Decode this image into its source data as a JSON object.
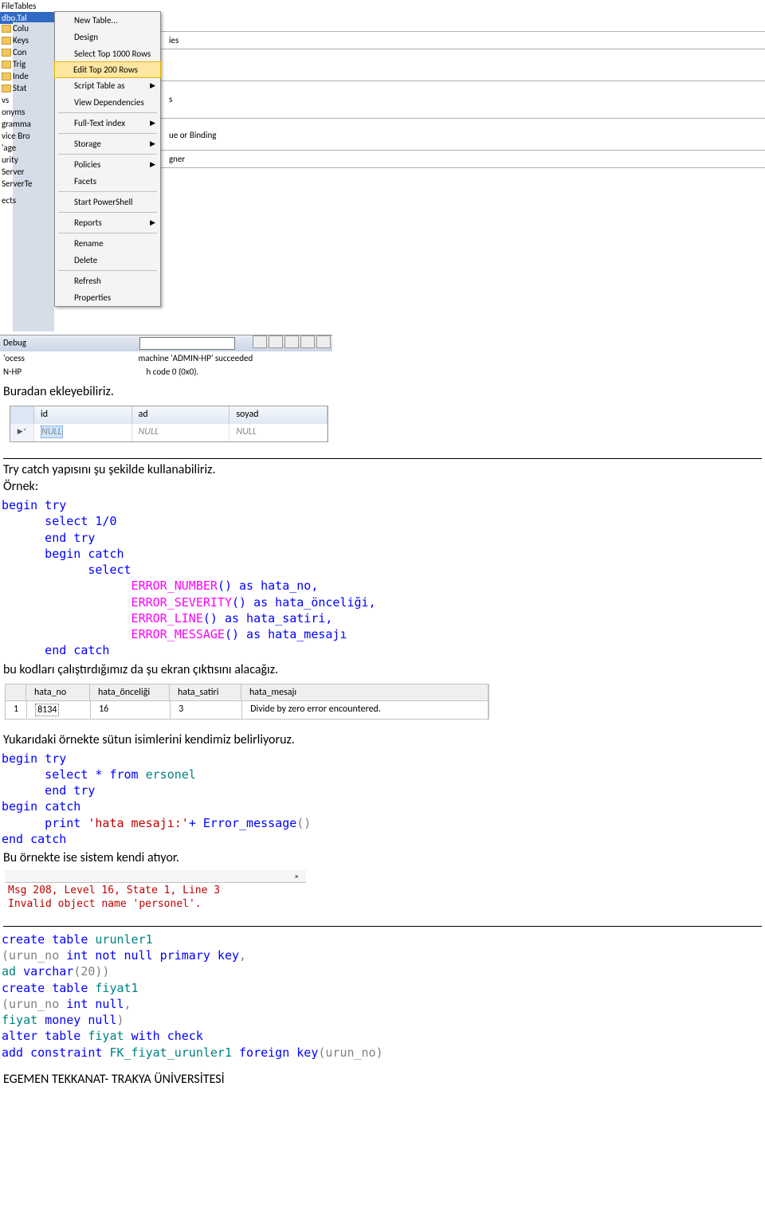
{
  "ssms": {
    "tree_header": "FileTables",
    "tree_selected": "dbo.Tal",
    "tree_items": [
      "Colu",
      "Keys",
      "Con",
      "Trig",
      "Inde",
      "Stat"
    ],
    "tree_plain": [
      "vs",
      "onyms",
      "gramma",
      "vice Bro",
      "'age",
      "urity",
      "Server",
      "ServerTe"
    ],
    "tree_item9": "ects",
    "ctx": [
      "New Table...",
      "Design",
      "Select Top 1000 Rows",
      "Edit Top 200 Rows",
      "Script Table as",
      "View Dependencies",
      "Full-Text index",
      "Storage",
      "Policies",
      "Facets",
      "Start PowerShell",
      "Reports",
      "Rename",
      "Delete",
      "Refresh",
      "Properties"
    ],
    "right_frag1": "ies",
    "right_frag2": "s",
    "right_frag3": "ue or Binding",
    "right_frag4": "gner",
    "debug_label": "Debug",
    "proc_line": "'ocess",
    "hp_line": "N-HP",
    "proc_text1": "machine 'ADMIN-HP' succeeded",
    "proc_text2": "h code 0 (0x0)."
  },
  "text": {
    "buradan": "Buradan ekleyebiliriz.",
    "trycatch_intro": "Try catch yapısını şu şekilde kullanabiliriz.",
    "ornek": "Örnek:",
    "ekran": "bu kodları çalıştırdığımız da şu ekran çıktısını alacağız.",
    "yukaridaki": "Yukarıdaki örnekte sütun isimlerini kendimiz belirliyoruz.",
    "bu_ornekte": "Bu örnekte ise sistem kendi atıyor.",
    "footer": "EGEMEN TEKKANAT- TRAKYA ÜNİVERSİTESİ"
  },
  "grid2": {
    "headers": [
      "id",
      "ad",
      "soyad"
    ],
    "null_row": [
      "NULL",
      "NULL",
      "NULL"
    ],
    "star": "▶*"
  },
  "code1": {
    "l1": "begin try",
    "l2": "      select 1/0",
    "l3": "      end try",
    "l4": "      begin catch",
    "l5": "            select",
    "l6a": "                  ERROR_NUMBER",
    "l6b": "() as hata_no,",
    "l7a": "                  ERROR_SEVERITY",
    "l7b": "() as hata_önceliği,",
    "l8a": "                  ERROR_LINE",
    "l8b": "() as hata_satiri,",
    "l9a": "                  ERROR_MESSAGE",
    "l9b": "() as hata_mesajı",
    "l10": "      end catch"
  },
  "rgrid": {
    "hdr": [
      "hata_no",
      "hata_önceliği",
      "hata_satiri",
      "hata_mesajı"
    ],
    "row": [
      "1",
      "8134",
      "16",
      "3",
      "Divide by zero error encountered."
    ]
  },
  "code2": {
    "l1": "begin try",
    "l2a": "      select * from",
    "l2b": " ersonel",
    "l3": "      end try",
    "l4": "begin catch",
    "l5a": "      print ",
    "l5b": "'hata mesajı:'",
    "l5c": "+ Error_message",
    "l5d": "()",
    "l6": "end catch"
  },
  "msg": {
    "line1": "Msg 208, Level 16, State 1, Line 3",
    "line2": "Invalid object name 'personel'."
  },
  "code3": {
    "l1a": "create table",
    "l1b": " urunler1",
    "l2a": "(urun_no ",
    "l2b": "int not null primary key",
    "l2c": ",",
    "l3a": "ad ",
    "l3b": "varchar",
    "l3c": "(20))",
    "l4a": "create table",
    "l4b": " fiyat1",
    "l5a": "(urun_no ",
    "l5b": "int null",
    "l5c": ",",
    "l6a": "fiyat ",
    "l6b": "money null",
    "l6c": ")",
    "l7a": "alter table",
    "l7b": " fiyat ",
    "l7c": "with check",
    "l8a": "add constraint",
    "l8b": " FK_fiyat_urunler1 ",
    "l8c": "foreign key",
    "l8d": "(urun_no)"
  }
}
